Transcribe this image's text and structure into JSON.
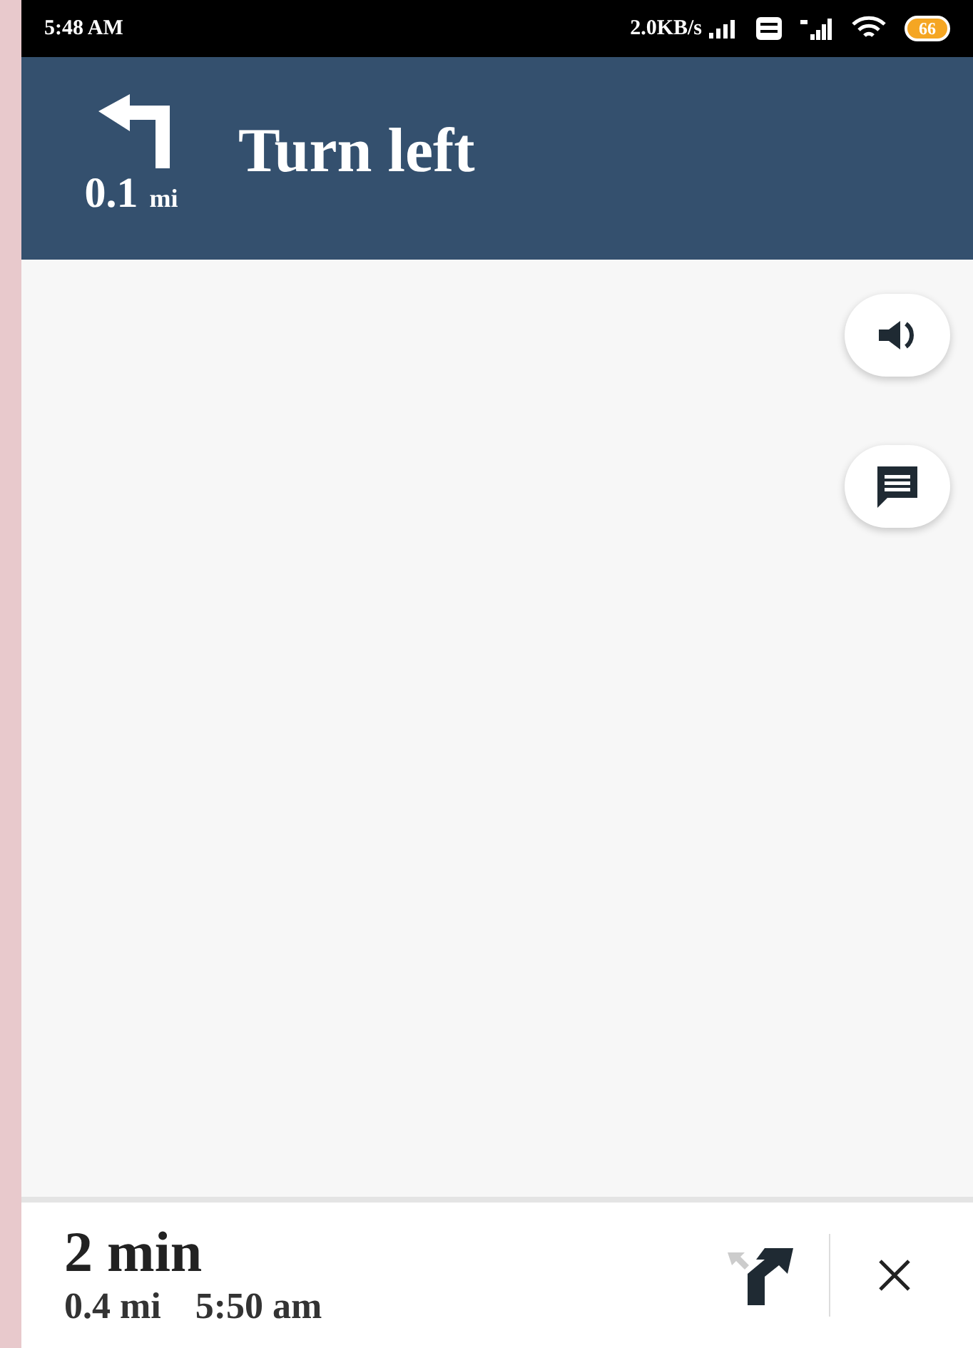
{
  "status_bar": {
    "time": "5:48 AM",
    "speed": "2.0KB/s",
    "battery": "66"
  },
  "instruction": {
    "distance": "0.1",
    "unit": "mi",
    "text": "Turn left"
  },
  "map_buttons": [
    {
      "kind": "sound"
    },
    {
      "kind": "message"
    }
  ],
  "trip": {
    "duration": "2 min",
    "distance": "0.4 mi",
    "arrival": "5:50 am"
  }
}
